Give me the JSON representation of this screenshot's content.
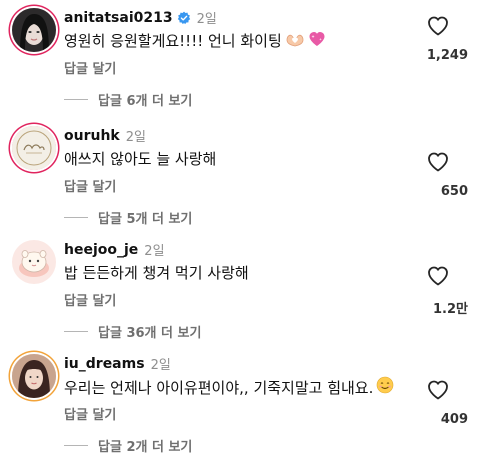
{
  "comments": [
    {
      "username": "anitatsai0213",
      "verified": true,
      "time": "2일",
      "text": "영원히 응원할게요!!!! 언니 화이팅",
      "emojis": [
        "heart-hands-emoji",
        "sparkling-heart-emoji"
      ],
      "reply_label": "답글 달기",
      "view_replies": "답글 6개 더 보기",
      "likes": "1,249"
    },
    {
      "username": "ouruhk",
      "verified": false,
      "time": "2일",
      "text": "애쓰지 않아도 늘 사랑해",
      "emojis": [],
      "reply_label": "답글 달기",
      "view_replies": "답글 5개 더 보기",
      "likes": "650"
    },
    {
      "username": "heejoo_je",
      "verified": false,
      "time": "2일",
      "text": "밥 든든하게 챙겨 먹기 사랑해",
      "emojis": [],
      "reply_label": "답글 달기",
      "view_replies": "답글 36개 더 보기",
      "likes": "1.2만"
    },
    {
      "username": "iu_dreams",
      "verified": false,
      "time": "2일",
      "text": "우리는 언제나 아이유편이야,, 기죽지말고 힘내요.",
      "emojis": [
        "smiling-face-emoji"
      ],
      "reply_label": "답글 달기",
      "view_replies": "답글 2개 더 보기",
      "likes": "409"
    }
  ],
  "colors": {
    "verified_badge": "#3897f0",
    "story_ring_pink": "#e0245e",
    "story_ring_orange": "#f2a33a",
    "secondary_text": "#6f6f6f",
    "time_text": "#8e8e8e"
  }
}
